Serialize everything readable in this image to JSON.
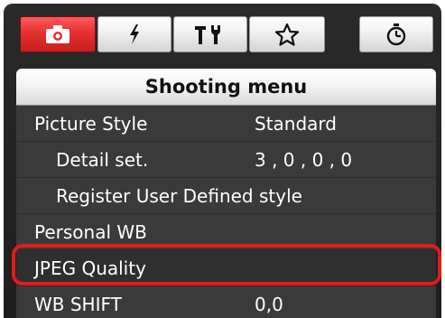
{
  "tabs": [
    {
      "icon": "camera-icon",
      "active": true
    },
    {
      "icon": "flash-icon",
      "active": false
    },
    {
      "icon": "tools-icon",
      "active": false
    },
    {
      "icon": "star-icon",
      "active": false
    },
    {
      "icon": "timer-icon",
      "active": false
    }
  ],
  "menu": {
    "title": "Shooting menu",
    "items": [
      {
        "label": "Picture Style",
        "value": "Standard"
      },
      {
        "label": "Detail set.",
        "value": "3 , 0 , 0 , 0"
      },
      {
        "label": "Register User Defined style",
        "value": ""
      },
      {
        "label": "Personal WB",
        "value": ""
      },
      {
        "label": "JPEG Quality",
        "value": "",
        "highlighted": true
      },
      {
        "label": "WB SHIFT",
        "value": "0,0"
      }
    ]
  },
  "colors": {
    "active_tab": "#e53030",
    "highlight_outline": "#e11b1b",
    "panel_bg": "#3a3a3a"
  }
}
